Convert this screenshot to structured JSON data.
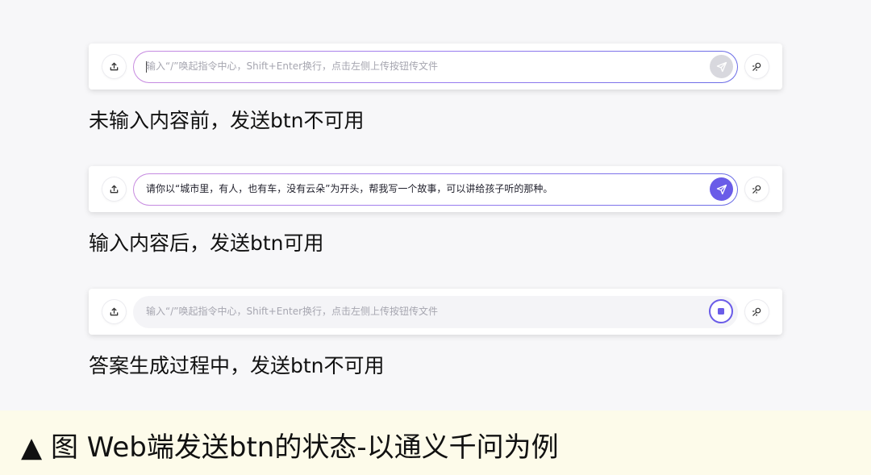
{
  "demos": [
    {
      "state": "empty",
      "placeholder": "输入“/”唤起指令中心，Shift+Enter换行，点击左侧上传按钮传文件",
      "value": "",
      "send_state": "disabled",
      "caption": "未输入内容前，发送btn不可用"
    },
    {
      "state": "typed",
      "placeholder": "",
      "value": "请你以“城市里，有人，也有车，没有云朵”为开头，帮我写一个故事，可以讲给孩子听的那种。",
      "send_state": "enabled",
      "caption": "输入内容后，发送btn可用"
    },
    {
      "state": "generating",
      "placeholder": "输入“/”唤起指令中心，Shift+Enter换行，点击左侧上传按钮传文件",
      "value": "",
      "send_state": "stop",
      "caption": "答案生成过程中，发送btn不可用"
    }
  ],
  "footer": {
    "title": "▲ 图 Web端发送btn的状态-以通义千问为例"
  },
  "colors": {
    "accent": "#6a5ce8",
    "disabled": "#d8d8de",
    "footer_bg": "#fdfbea"
  },
  "icons": [
    "upload-icon",
    "send-icon",
    "stop-icon",
    "tool-icon"
  ]
}
